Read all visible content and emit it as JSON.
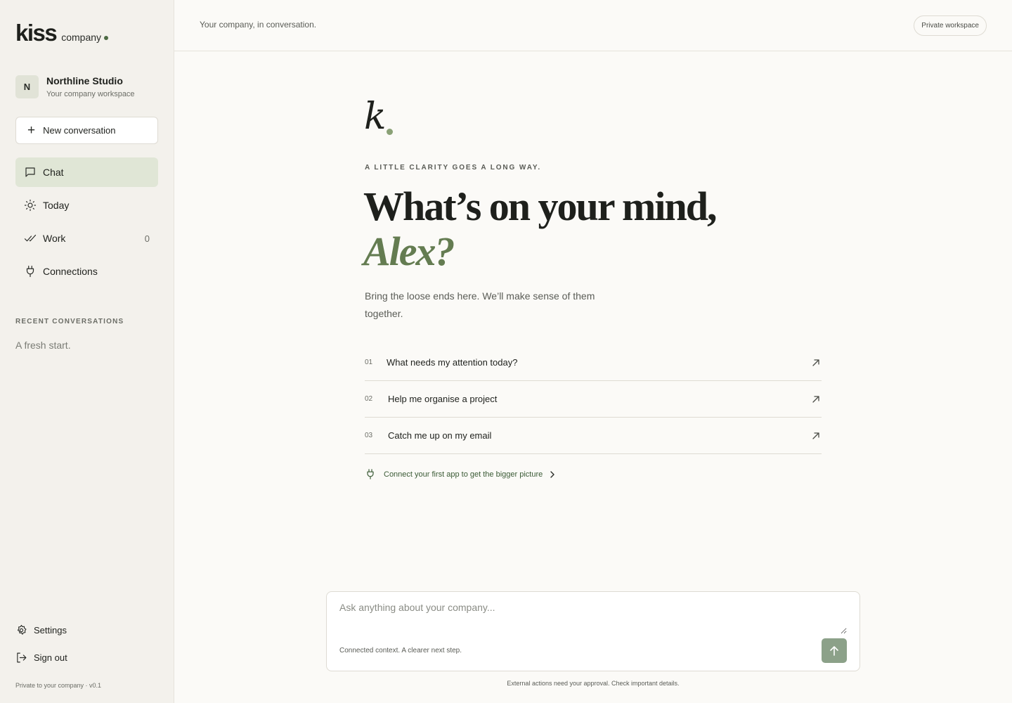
{
  "brand": {
    "logo": "kiss",
    "subtitle": "company",
    "accent_color": "#4d6b44"
  },
  "workspace": {
    "initial": "N",
    "name": "Northline Studio",
    "description": "Your company workspace"
  },
  "sidebar": {
    "new_conversation_label": "New conversation",
    "nav": [
      {
        "label": "Chat",
        "icon": "chat-icon",
        "active": true
      },
      {
        "label": "Today",
        "icon": "sun-icon"
      },
      {
        "label": "Work",
        "icon": "double-check-icon",
        "count": "0"
      },
      {
        "label": "Connections",
        "icon": "plug-icon"
      }
    ],
    "recent_title": "RECENT CONVERSATIONS",
    "recent_empty": "A fresh start.",
    "settings_label": "Settings",
    "signout_label": "Sign out",
    "version": "Private to your company · v0.1"
  },
  "header": {
    "tagline": "Your company, in conversation.",
    "badge": "Private workspace"
  },
  "main": {
    "mark": "k",
    "eyebrow": "A LITTLE CLARITY GOES A LONG WAY.",
    "headline": "What’s on your mind,",
    "headline_name": "Alex?",
    "subtext": "Bring the loose ends here. We’ll make sense of them together.",
    "prompts": [
      {
        "num": "01",
        "text": "What needs my attention today?"
      },
      {
        "num": "02",
        "text": "Help me organise a project"
      },
      {
        "num": "03",
        "text": "Catch me up on my email"
      }
    ],
    "connect_link": "Connect your first app to get the bigger picture"
  },
  "composer": {
    "placeholder": "Ask anything about your company...",
    "footer": "Connected context. A clearer next step.",
    "disclaimer": "External actions need your approval. Check important details."
  }
}
